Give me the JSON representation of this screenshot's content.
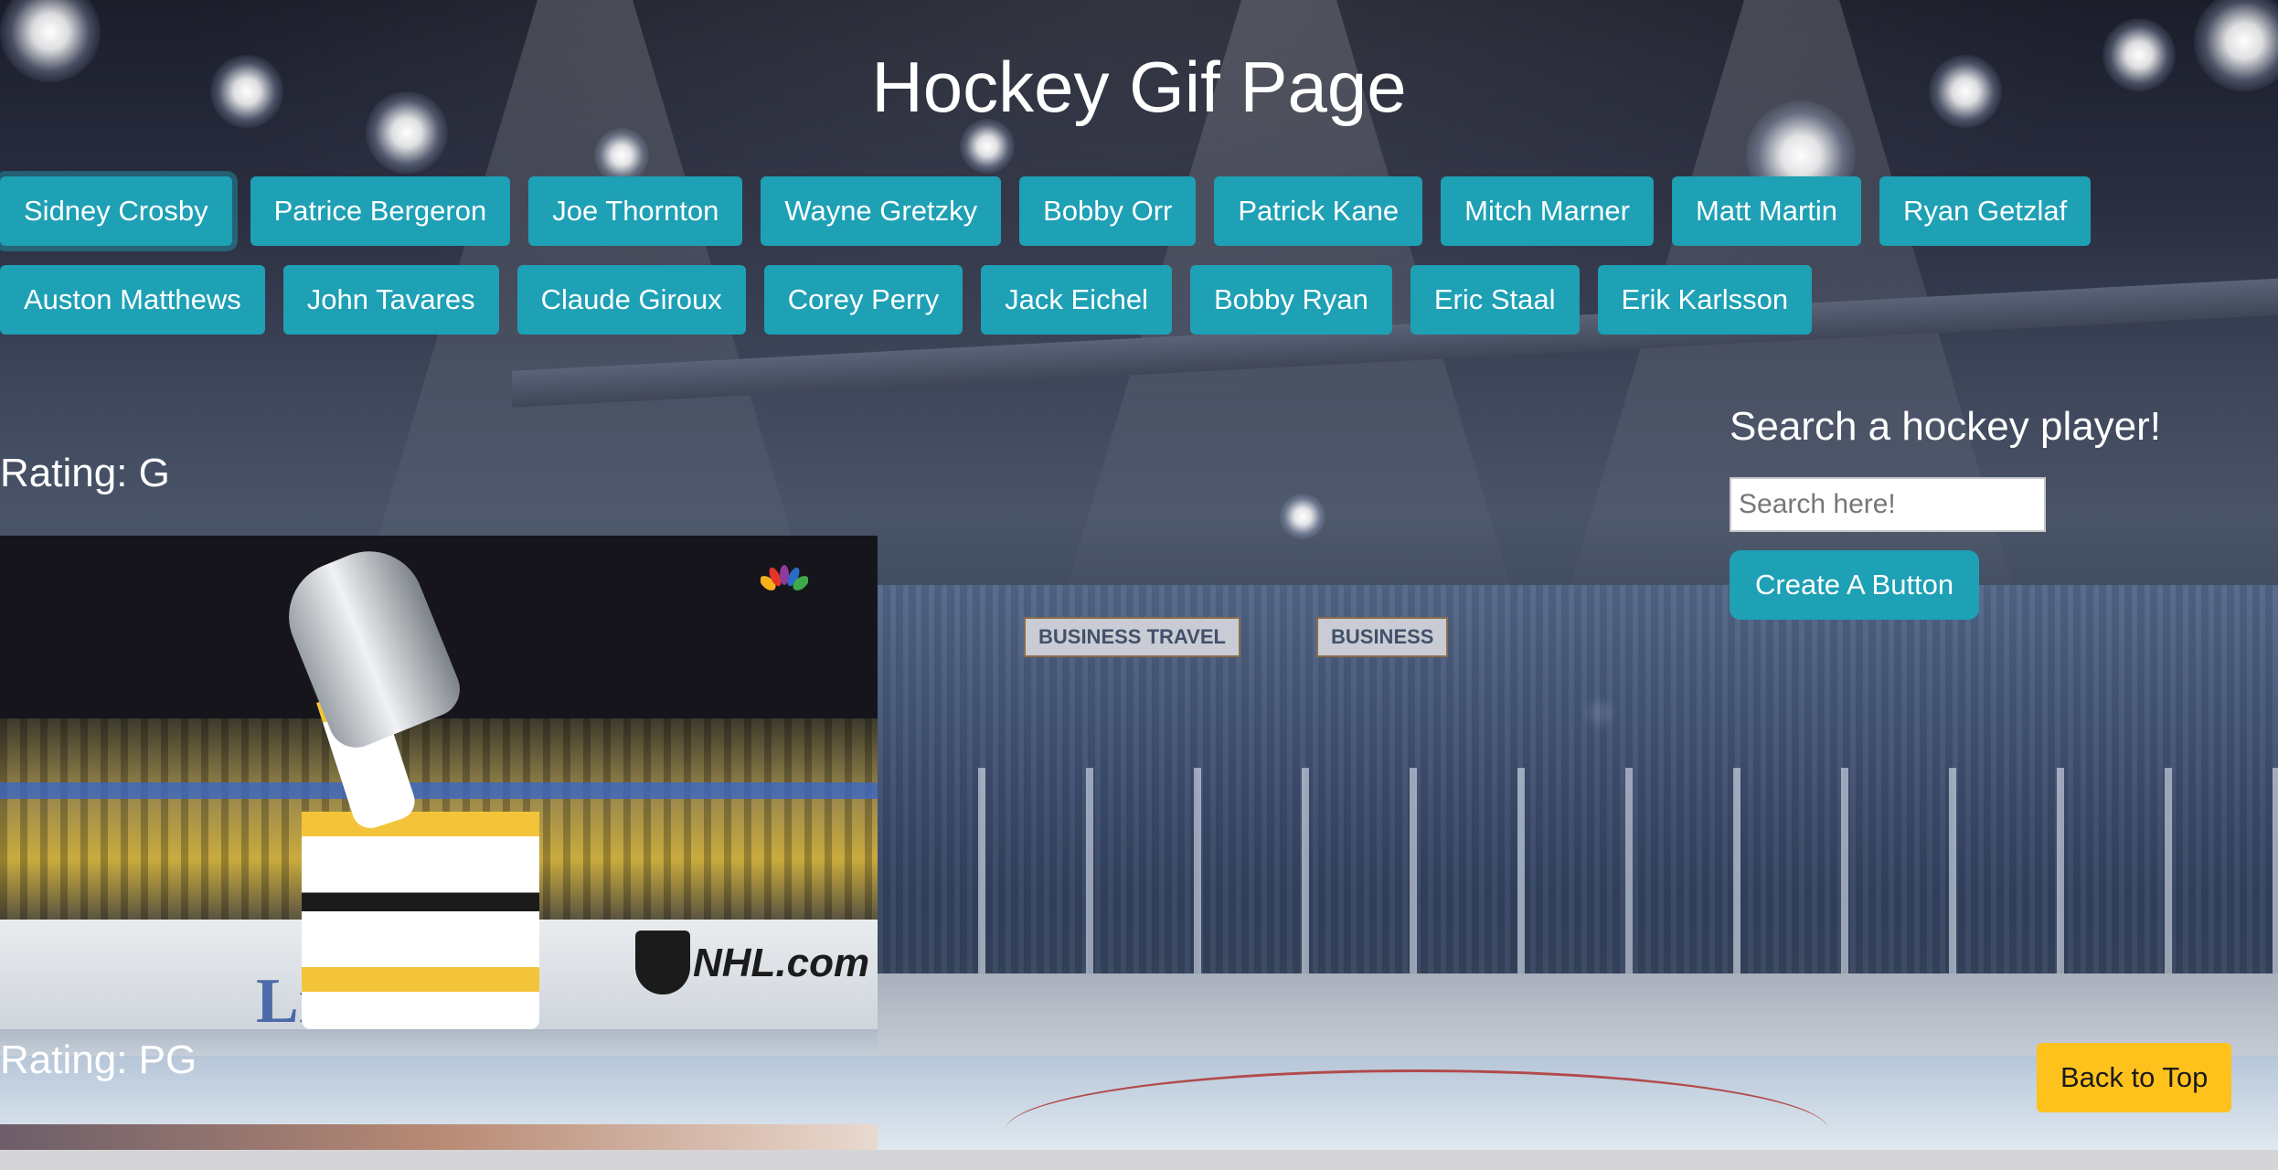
{
  "header": {
    "title": "Hockey Gif Page"
  },
  "players": {
    "row1": [
      "Sidney Crosby",
      "Patrice Bergeron",
      "Joe Thornton",
      "Wayne Gretzky",
      "Bobby Orr",
      "Patrick Kane",
      "Mitch Marner",
      "Matt Martin",
      "Ryan Getzlaf"
    ],
    "row2": [
      "Auston Matthews",
      "John Tavares",
      "Claude Giroux",
      "Corey Perry",
      "Jack Eichel",
      "Bobby Ryan",
      "Eric Staal",
      "Erik Karlsson"
    ]
  },
  "results": [
    {
      "rating": "Rating: G"
    },
    {
      "rating": "Rating: PG"
    }
  ],
  "gif_overlay": {
    "network_logo": "nbc-peacock-icon",
    "board_brand": "NHL.com"
  },
  "search": {
    "heading": "Search a hockey player!",
    "placeholder": "Search here!",
    "value": "",
    "create_label": "Create A Button"
  },
  "footer": {
    "back_to_top_label": "Back to Top"
  },
  "colors": {
    "button": "#1ea0b5",
    "back_to_top": "#ffc21c",
    "text": "#ffffff"
  }
}
